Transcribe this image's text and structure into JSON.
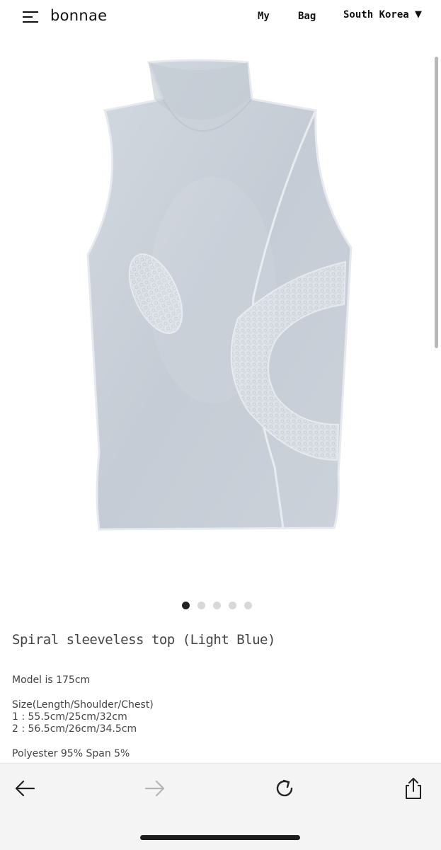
{
  "header": {
    "logo": "bonnae",
    "nav": {
      "my": "My",
      "bag": "Bag",
      "country": "South Korea"
    },
    "caret": "▼"
  },
  "carousel": {
    "count": 5,
    "active_index": 0
  },
  "product": {
    "title": "Spiral sleeveless top (Light Blue)",
    "model": "Model is 175cm",
    "size_heading": "Size(Length/Shoulder/Chest)",
    "size_1": "1 : 55.5cm/25cm/32cm",
    "size_2": "2 : 56.5cm/26cm/34.5cm",
    "fabric": "Polyester 95% Span 5%"
  },
  "colors": {
    "garment": "#c9d0d8",
    "lace": "#dfe4ea",
    "toolbar": "#f4f4f4",
    "accent": "#007aff"
  },
  "icons": {
    "menu": "menu-icon",
    "back": "arrow-left-icon",
    "forward": "arrow-right-icon",
    "reload": "reload-icon",
    "share": "share-icon"
  }
}
